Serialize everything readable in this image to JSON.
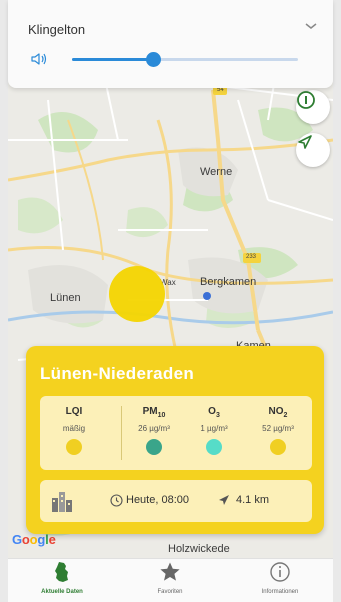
{
  "volume": {
    "title": "Klingelton",
    "level": 0.36,
    "accent_color": "#2a8ad8",
    "icons": [
      "speaker-icon",
      "chevron-down-icon"
    ]
  },
  "map": {
    "labels": {
      "werne": "Werne",
      "luenen": "Lünen",
      "bergkamen": "Bergkamen",
      "kamen": "Kamen",
      "holzwickede": "Holzwickede",
      "waltrop": "Wax",
      "road_54": "54",
      "road_233": "233"
    },
    "google": "Google",
    "buttons": [
      "info-icon",
      "location-arrow-icon"
    ]
  },
  "station": {
    "name": "Lünen-Niederaden",
    "card_color": "#f4d21f",
    "values": [
      {
        "label": "LQI",
        "sub": "",
        "value": "mäßig",
        "dot_color": "#f0cf22"
      },
      {
        "label": "PM",
        "sub": "10",
        "value": "26 µg/m³",
        "dot_color": "#3aa58a"
      },
      {
        "label": "O",
        "sub": "3",
        "value": "1 µg/m³",
        "dot_color": "#56dcc8"
      },
      {
        "label": "NO",
        "sub": "2",
        "value": "52 µg/m³",
        "dot_color": "#f0cf22"
      }
    ],
    "time": "Heute, 08:00",
    "distance": "4.1 km"
  },
  "nav": {
    "items": [
      {
        "label": "Aktuelle Daten",
        "icon": "germany-map-icon",
        "active": true
      },
      {
        "label": "Favoriten",
        "icon": "star-icon",
        "active": false
      },
      {
        "label": "Informationen",
        "icon": "info-icon",
        "active": false
      }
    ]
  }
}
